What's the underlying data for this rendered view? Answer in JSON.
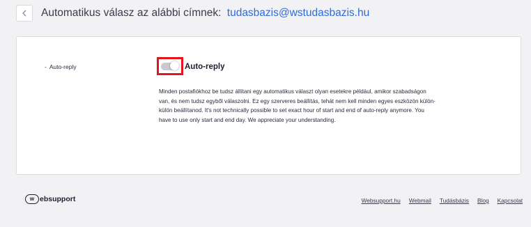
{
  "header": {
    "title": "Automatikus válasz az alábbi címnek:",
    "email": "tudasbazis@wstudasbazis.hu",
    "back_icon": "chevron-left-icon"
  },
  "settings": {
    "side_label": "Auto-reply",
    "toggle_state": "off",
    "title": "Auto-reply",
    "description": "Minden postafiókhoz be tudsz állítani egy automatikus választ olyan esetekre például, amikor szabadságon van, és nem tudsz egyből válaszolni. Ez egy szerveres beállítás, tehát nem kell minden egyes eszközön külön-külön beállítanod. It's not technically possible to set exact hour of start and end of auto-reply anymore. You have to use only start and end day. We appreciate your understanding.",
    "highlight_color": "#e4161b"
  },
  "footer": {
    "logo_mark": "w",
    "logo_text": "ebsupport",
    "links": [
      "Websupport.hu",
      "Webmail",
      "Tudásbázis",
      "Blog",
      "Kapcsolat"
    ]
  }
}
